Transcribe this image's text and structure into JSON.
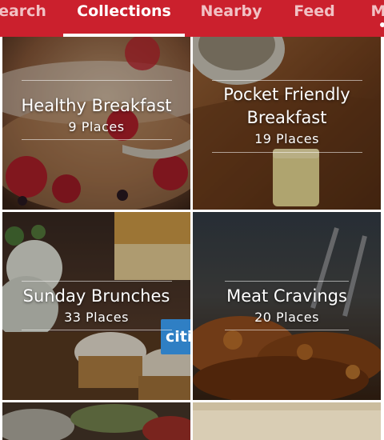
{
  "nav": {
    "tabs": [
      {
        "label": "earch",
        "active": false
      },
      {
        "label": "Collections",
        "active": true
      },
      {
        "label": "Nearby",
        "active": false
      },
      {
        "label": "Feed",
        "active": false
      },
      {
        "label": "M",
        "active": false
      }
    ],
    "accent_color": "#cb202d"
  },
  "collections": [
    {
      "title": "Healthy Breakfast",
      "count": "9 Places"
    },
    {
      "title_line1": "Pocket Friendly",
      "title_line2": "Breakfast",
      "count": "19 Places"
    },
    {
      "title": "Sunday Brunches",
      "count": "33 Places",
      "badge": "citi"
    },
    {
      "title": "Meat Cravings",
      "count": "20 Places"
    }
  ]
}
